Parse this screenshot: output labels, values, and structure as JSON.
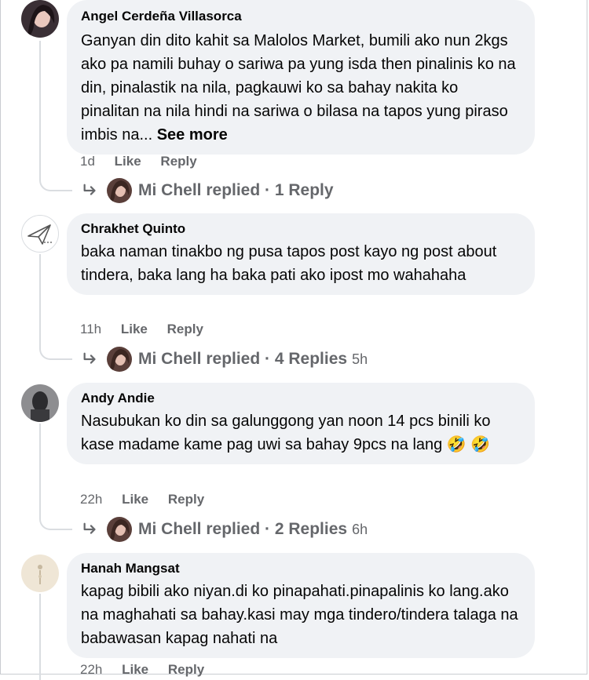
{
  "comments": [
    {
      "author": "Angel Cerdeña Villasorca",
      "text": "Ganyan din dito kahit sa Malolos Market, bumili ako nun 2kgs ako pa namili buhay o sariwa pa yung isda then pinalinis ko na din, pinalastik na nila, pagkauwi ko sa bahay nakita ko pinalitan na nila hindi na sariwa o bilasa na tapos yung piraso imbis na...",
      "see_more": "See more",
      "time": "1d",
      "like": "Like",
      "reply": "Reply",
      "replied_name": "Mi Chell replied",
      "replied_count": "· 1 Reply",
      "replied_time": ""
    },
    {
      "author": "Chrakhet Quinto",
      "text": "baka naman tinakbo ng pusa tapos post kayo ng post about tindera, baka lang ha baka pati ako ipost mo wahahaha",
      "time": "11h",
      "like": "Like",
      "reply": "Reply",
      "replied_name": "Mi Chell replied",
      "replied_count": "· 4 Replies",
      "replied_time": "5h"
    },
    {
      "author": "Andy Andie",
      "text": "Nasubukan ko din sa galunggong yan noon 14 pcs binili ko kase madame kame pag uwi sa bahay 9pcs na lang",
      "emoji": "🤣",
      "time": "22h",
      "like": "Like",
      "reply": "Reply",
      "replied_name": "Mi Chell replied",
      "replied_count": "· 2 Replies",
      "replied_time": "6h"
    },
    {
      "author": "Hanah Mangsat",
      "text": "kapag bibili ako niyan.di ko pinapahati.pinapalinis ko lang.ako na maghahati sa bahay.kasi may mga tindero/tindera talaga na babawasan kapag nahati na",
      "time": "22h",
      "like": "Like",
      "reply": "Reply"
    }
  ],
  "icons": {
    "reply_arrow": "reply-arrow-icon",
    "emoji": "rolling-laughing-emoji"
  },
  "colors": {
    "bubble": "#f0f2f5",
    "meta": "#65676b",
    "thread_line": "#dadde1"
  }
}
